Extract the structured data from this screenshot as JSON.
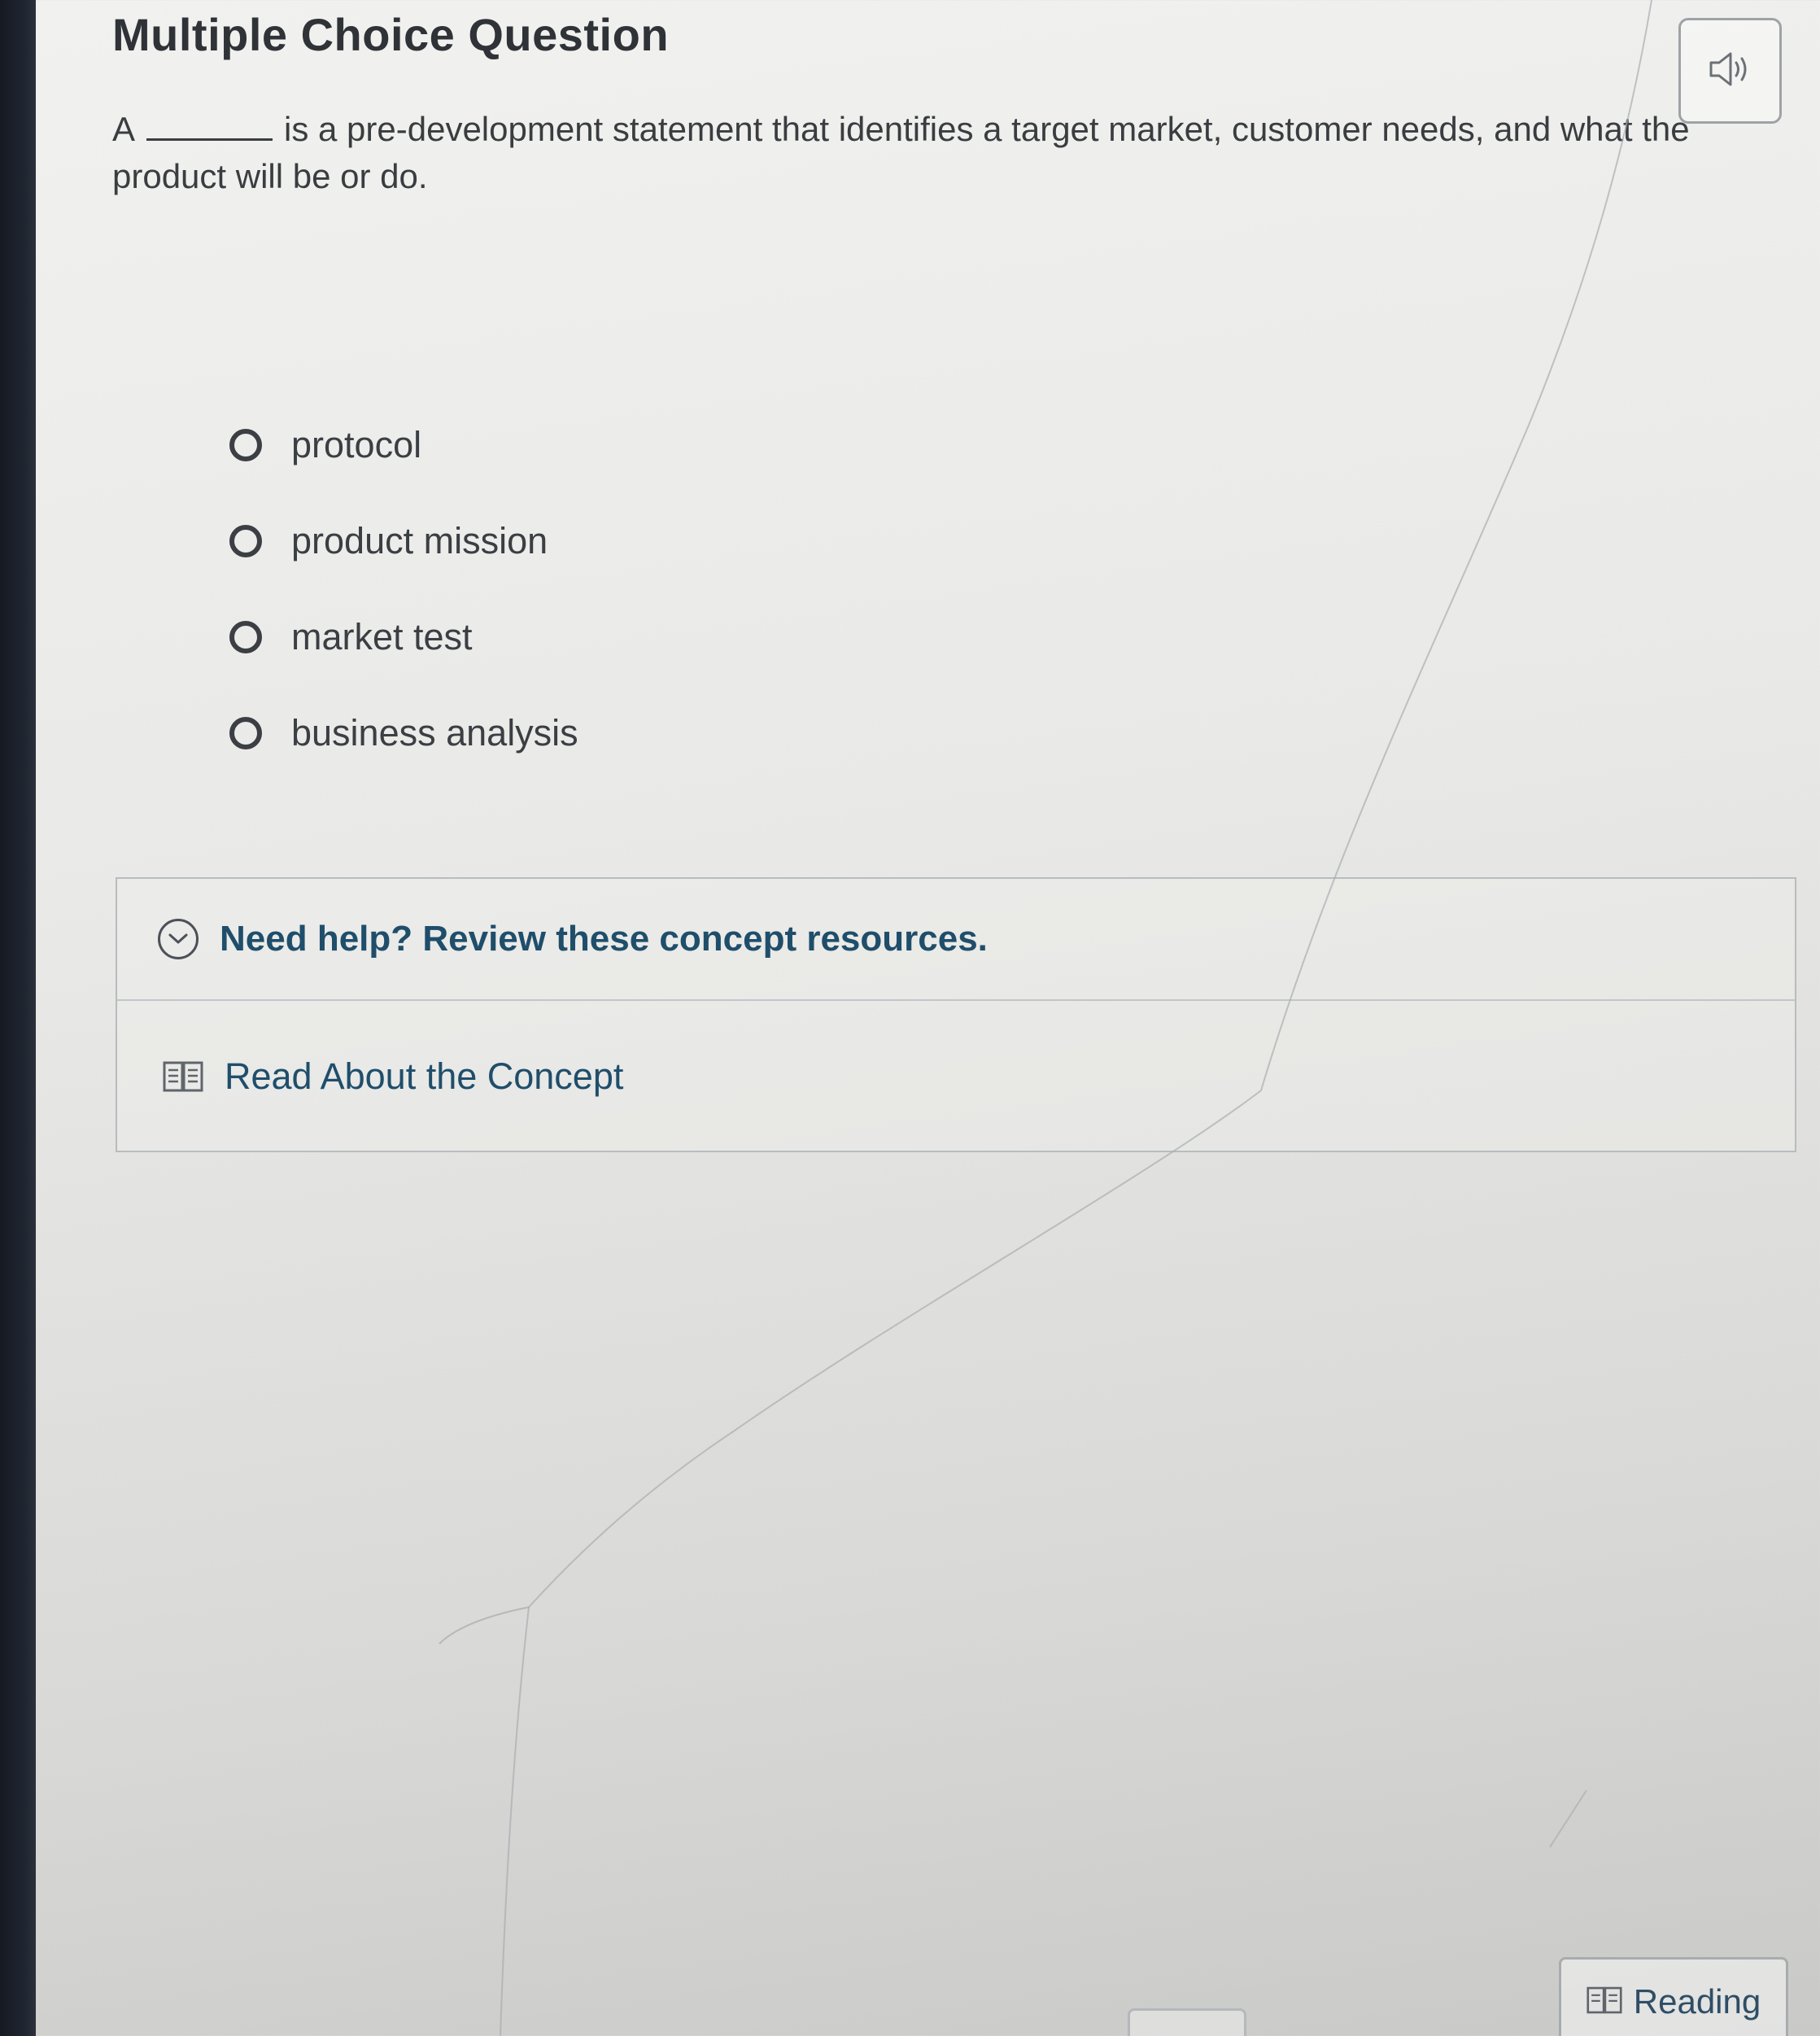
{
  "page": {
    "title": "Multiple Choice Question"
  },
  "question": {
    "prefix": "A",
    "text": "is a pre-development statement that identifies a target market, customer needs, and what the product will be or do."
  },
  "options": [
    {
      "label": "protocol"
    },
    {
      "label": "product mission"
    },
    {
      "label": "market test"
    },
    {
      "label": "business analysis"
    }
  ],
  "help": {
    "header": "Need help? Review these concept resources.",
    "link": "Read About the Concept"
  },
  "footer": {
    "reading_label": "Reading"
  },
  "icons": {
    "audio": "speaker-icon",
    "expand": "chevron-down-circle-icon",
    "book": "book-icon"
  },
  "colors": {
    "link_blue": "#1f4e6b",
    "text_dark": "#3a3d40"
  }
}
